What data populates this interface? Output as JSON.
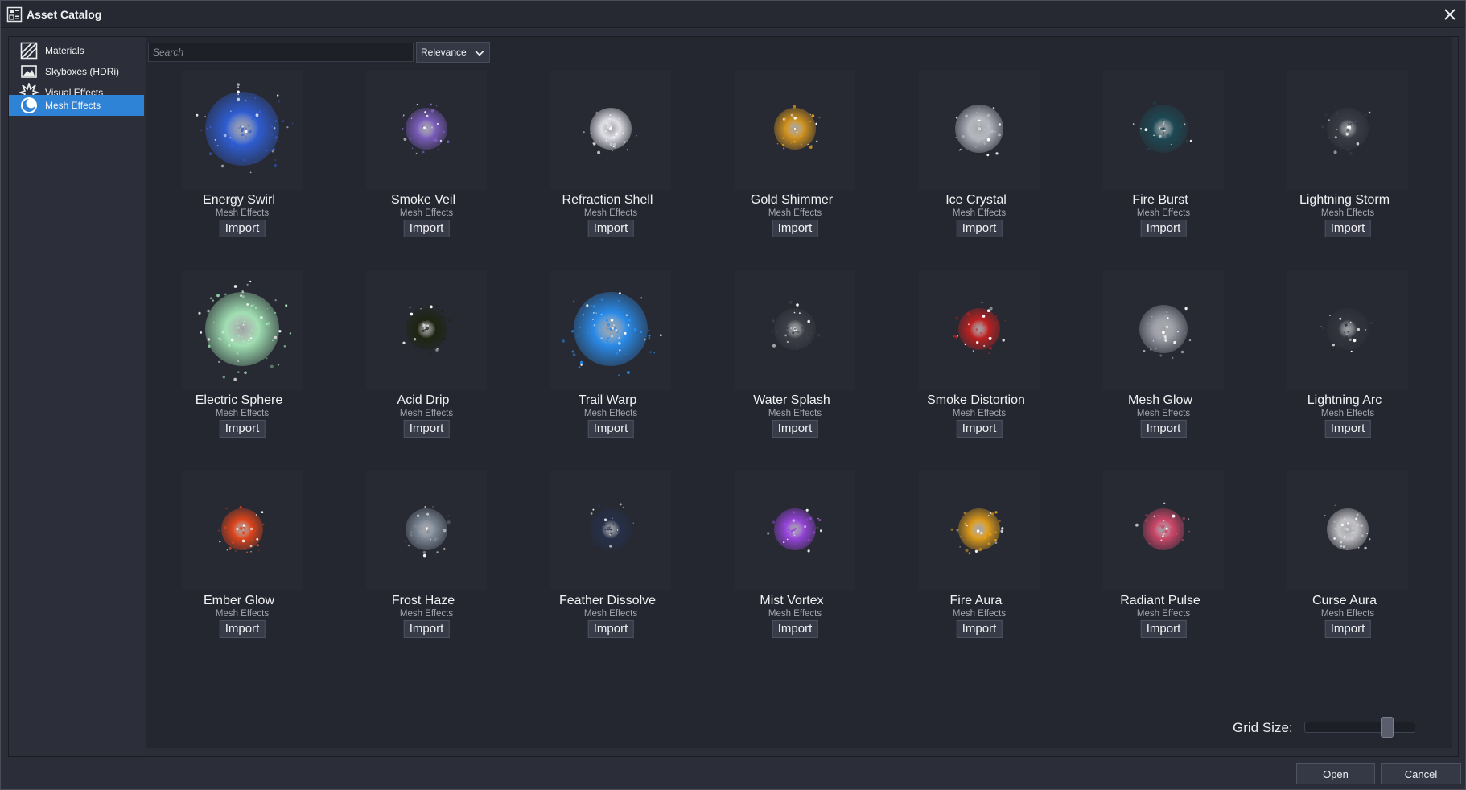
{
  "window": {
    "title": "Asset Catalog",
    "app_icon": "catalog-icon",
    "close_icon": "close-icon"
  },
  "sidebar": {
    "items": [
      {
        "label": "Materials",
        "icon": "materials-icon",
        "active": false
      },
      {
        "label": "Skyboxes (HDRi)",
        "icon": "skybox-icon",
        "active": false
      },
      {
        "label": "Visual Effects",
        "icon": "burst-icon",
        "active": false
      },
      {
        "label": "Mesh Effects",
        "icon": "sphere-icon",
        "active": true
      }
    ]
  },
  "toolbar": {
    "search_placeholder": "Search",
    "sort_value": "Relevance"
  },
  "assets": [
    {
      "name": "Energy Swirl",
      "category": "Mesh Effects",
      "button": "Import",
      "color": "#2f5fd8"
    },
    {
      "name": "Smoke Veil",
      "category": "Mesh Effects",
      "button": "Import",
      "color": "#7e5fc0"
    },
    {
      "name": "Refraction Shell",
      "category": "Mesh Effects",
      "button": "Import",
      "color": "#e8e8ee"
    },
    {
      "name": "Gold Shimmer",
      "category": "Mesh Effects",
      "button": "Import",
      "color": "#d7961e"
    },
    {
      "name": "Ice Crystal",
      "category": "Mesh Effects",
      "button": "Import",
      "color": "#b9bcc4"
    },
    {
      "name": "Fire Burst",
      "category": "Mesh Effects",
      "button": "Import",
      "color": "#1d4a55"
    },
    {
      "name": "Lightning Storm",
      "category": "Mesh Effects",
      "button": "Import",
      "color": "#3a3c46"
    },
    {
      "name": "Electric Sphere",
      "category": "Mesh Effects",
      "button": "Import",
      "color": "#a6e8b8"
    },
    {
      "name": "Acid Drip",
      "category": "Mesh Effects",
      "button": "Import",
      "color": "#1e2410"
    },
    {
      "name": "Trail Warp",
      "category": "Mesh Effects",
      "button": "Import",
      "color": "#2a8ff0"
    },
    {
      "name": "Water Splash",
      "category": "Mesh Effects",
      "button": "Import",
      "color": "#3d4048"
    },
    {
      "name": "Smoke Distortion",
      "category": "Mesh Effects",
      "button": "Import",
      "color": "#c42020"
    },
    {
      "name": "Mesh Glow",
      "category": "Mesh Effects",
      "button": "Import",
      "color": "#9da0a8"
    },
    {
      "name": "Lightning Arc",
      "category": "Mesh Effects",
      "button": "Import",
      "color": "#33353f"
    },
    {
      "name": "Ember Glow",
      "category": "Mesh Effects",
      "button": "Import",
      "color": "#e8461a"
    },
    {
      "name": "Frost Haze",
      "category": "Mesh Effects",
      "button": "Import",
      "color": "#7f8a98"
    },
    {
      "name": "Feather Dissolve",
      "category": "Mesh Effects",
      "button": "Import",
      "color": "#25304a"
    },
    {
      "name": "Mist Vortex",
      "category": "Mesh Effects",
      "button": "Import",
      "color": "#9a45e0"
    },
    {
      "name": "Fire Aura",
      "category": "Mesh Effects",
      "button": "Import",
      "color": "#e6a019"
    },
    {
      "name": "Radiant Pulse",
      "category": "Mesh Effects",
      "button": "Import",
      "color": "#d2486a"
    },
    {
      "name": "Curse Aura",
      "category": "Mesh Effects",
      "button": "Import",
      "color": "#c8c8cc"
    }
  ],
  "grid_size": {
    "label": "Grid Size:",
    "value": 0.78
  },
  "footer": {
    "open_label": "Open",
    "cancel_label": "Cancel"
  }
}
